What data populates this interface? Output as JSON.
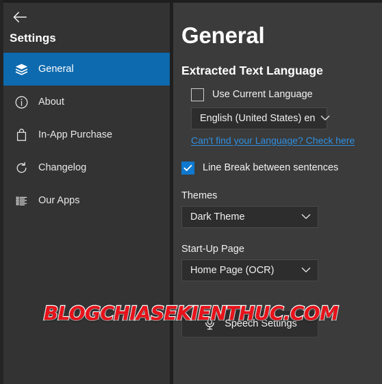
{
  "window": {
    "back_icon": "back-arrow-icon",
    "accent_color": "#0d6aaf",
    "checkbox_accent": "#0f79d0",
    "link_color": "#2f8fe0",
    "sidebar_bg": "#333333",
    "content_bg": "#3b3b3b"
  },
  "sidebar": {
    "title": "Settings",
    "items": [
      {
        "label": "General",
        "icon": "layers-icon",
        "selected": true
      },
      {
        "label": "About",
        "icon": "info-circle-icon",
        "selected": false
      },
      {
        "label": "In-App Purchase",
        "icon": "shopping-bag-icon",
        "selected": false
      },
      {
        "label": "Changelog",
        "icon": "history-icon",
        "selected": false
      },
      {
        "label": "Our Apps",
        "icon": "bulleted-list-icon",
        "selected": false
      }
    ]
  },
  "main": {
    "page_title": "General",
    "section_title": "Extracted Text Language",
    "use_current_language": {
      "label": "Use Current Language",
      "checked": false
    },
    "language_dropdown": {
      "value": "English (United States) en",
      "caret": "chevron-down-icon"
    },
    "language_help_link": "Can't find your Language? Check here",
    "line_break": {
      "label": "Line Break between sentences",
      "checked": true
    },
    "themes": {
      "label": "Themes",
      "value": "Dark Theme",
      "caret": "chevron-down-icon"
    },
    "startup_page": {
      "label": "Start-Up Page",
      "value": "Home Page (OCR)",
      "caret": "chevron-down-icon"
    },
    "speech_button": {
      "label": "Speech Settings",
      "icon": "microphone-icon"
    }
  },
  "watermark": {
    "text": "BLOGCHIASEKIENTHUC.COM",
    "color": "#e8121a"
  }
}
